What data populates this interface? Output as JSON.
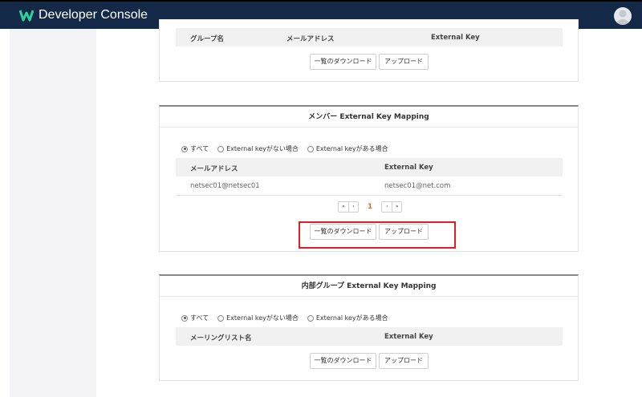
{
  "app": {
    "title": "Developer Console",
    "logo_icon": "w-logo-icon",
    "brand_color": "#142848",
    "logo_color": "#2bd39b"
  },
  "group_panel": {
    "columns": [
      "グループ名",
      "メールアドレス",
      "External Key"
    ],
    "download_label": "一覧のダウンロード",
    "upload_label": "アップロード"
  },
  "member_panel": {
    "title": "メンバー External Key Mapping",
    "filters": [
      {
        "label": "すべて",
        "checked": true
      },
      {
        "label": "External keyがない場合",
        "checked": false
      },
      {
        "label": "External keyがある場合",
        "checked": false
      }
    ],
    "columns": [
      "メールアドレス",
      "External Key"
    ],
    "rows": [
      {
        "email": "netsec01@netsec01",
        "external_key": "netsec01@net.com"
      }
    ],
    "pagination": {
      "current_page": "1",
      "first": "«",
      "prev": "‹",
      "next": "›",
      "last": "»"
    },
    "download_label": "一覧のダウンロード",
    "upload_label": "アップロード"
  },
  "internal_group_panel": {
    "title": "内部グループ External Key Mapping",
    "filters": [
      {
        "label": "すべて",
        "checked": true
      },
      {
        "label": "External keyがない場合",
        "checked": false
      },
      {
        "label": "External keyがある場合",
        "checked": false
      }
    ],
    "columns": [
      "メーリングリスト名",
      "External Key"
    ],
    "download_label": "一覧のダウンロード",
    "upload_label": "アップロード"
  },
  "highlight_color": "#e02020"
}
